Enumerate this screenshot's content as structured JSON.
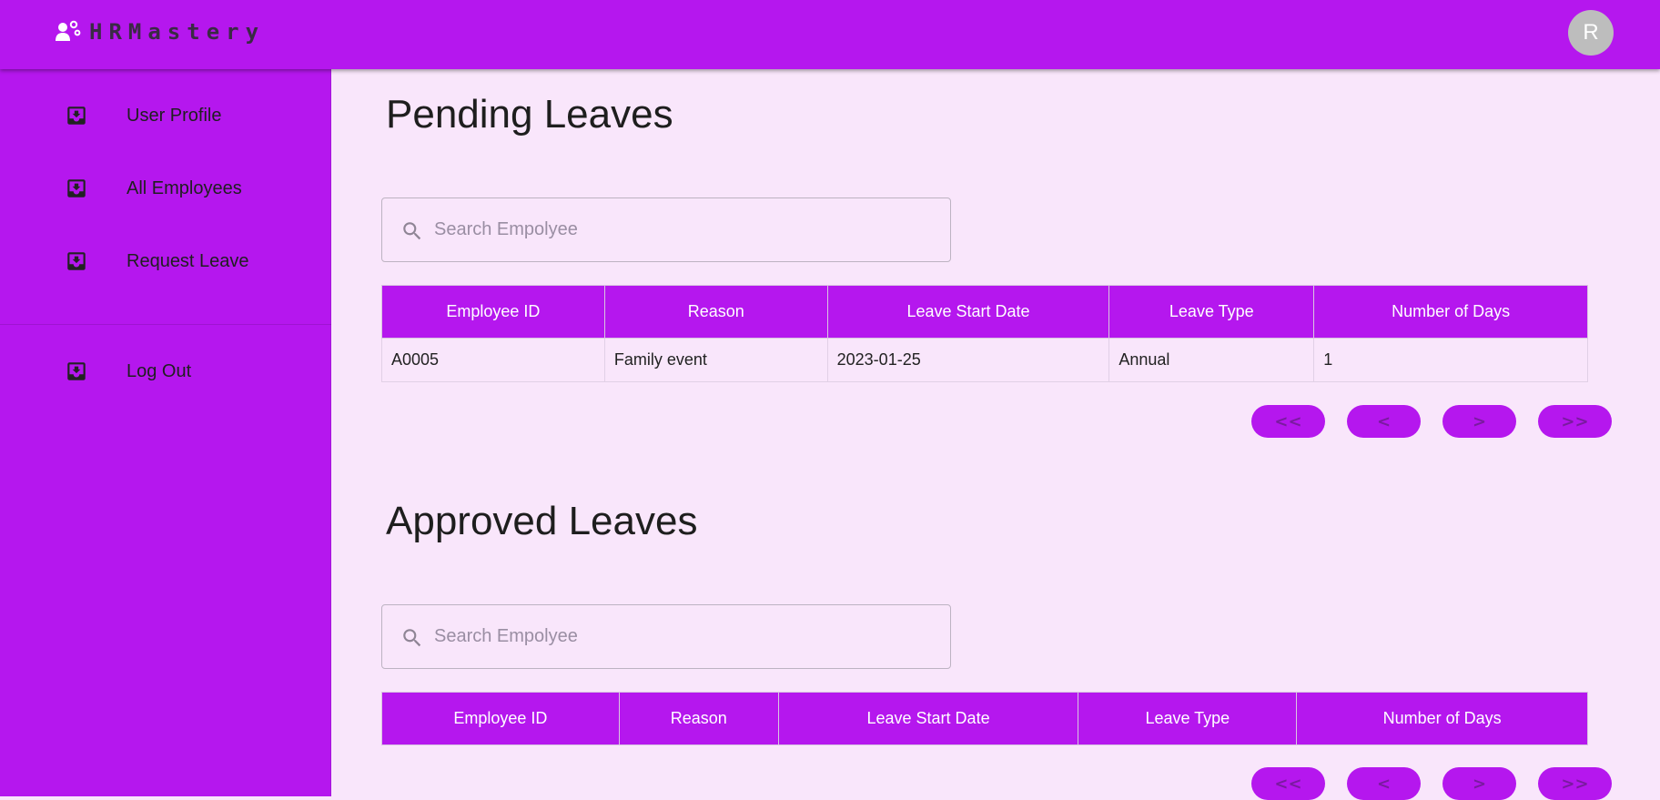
{
  "app": {
    "name": "HRMastery",
    "logo_icon": "people-gear-icon",
    "avatar_letter": "R",
    "accent_color": "#b517ee",
    "background_color": "#f9e6fb"
  },
  "sidebar": {
    "items": [
      {
        "label": "User Profile",
        "icon": "inbox-download-icon"
      },
      {
        "label": "All Employees",
        "icon": "inbox-download-icon"
      },
      {
        "label": "Request Leave",
        "icon": "inbox-download-icon"
      },
      {
        "label": "Log Out",
        "icon": "inbox-download-icon"
      }
    ]
  },
  "pending": {
    "title": "Pending Leaves",
    "search_placeholder": "Search Empolyee",
    "columns": [
      "Employee ID",
      "Reason",
      "Leave Start Date",
      "Leave Type",
      "Number of Days"
    ],
    "rows": [
      [
        "A0005",
        "Family event",
        "2023-01-25",
        "Annual",
        "1"
      ]
    ]
  },
  "approved": {
    "title": "Approved Leaves",
    "search_placeholder": "Search Empolyee",
    "columns": [
      "Employee ID",
      "Reason",
      "Leave Start Date",
      "Leave Type",
      "Number of Days"
    ],
    "rows": []
  },
  "pager": {
    "first": "<<",
    "prev": "<",
    "next": ">",
    "last": ">>"
  }
}
